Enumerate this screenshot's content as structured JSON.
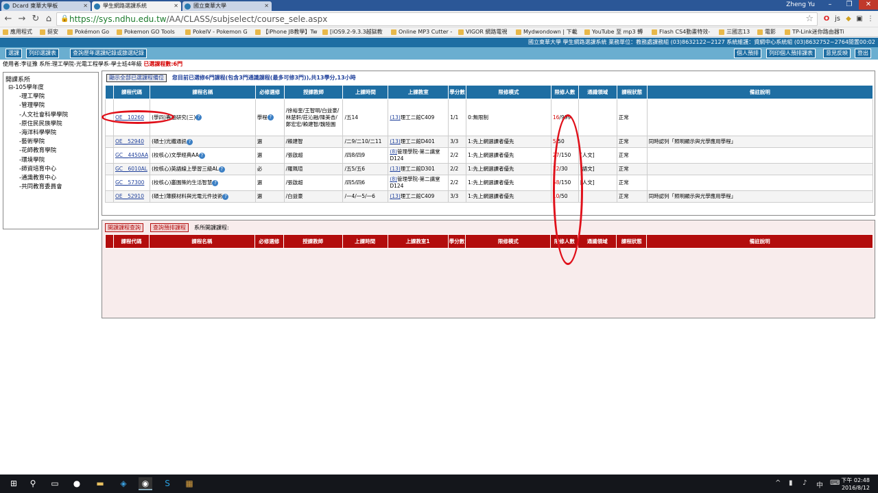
{
  "browser": {
    "tabs": [
      {
        "label": "Dcard 東華大學板",
        "active": false
      },
      {
        "label": "學生網路選課系統",
        "active": true
      },
      {
        "label": "國立東華大學",
        "active": false
      }
    ],
    "user": "Zheng Yu",
    "url_main": "https://sys.ndhu.edu.tw",
    "url_path": "/AA/CLASS/subjselect/course_sele.aspx",
    "bookmarks": [
      "應用程式",
      "挺安",
      "Pokémon Go",
      "Pokemon GO Tools",
      "PokeIV - Pokemon G",
      "【iPhone JB教學】Tw",
      "[iOS9.2-9.3.3越獄教",
      "Online MP3 Cutter -",
      "VIGOR 網路電視",
      "Mydwondown | 下載",
      "YouTube 至 mp3 轉",
      "Flash CS4動畫特效-",
      "三國志13",
      "電影",
      "TP-Link迷你路由器Ti"
    ]
  },
  "system": {
    "header": "國立東華大學 學生網路選課系統 業務單位：教務處課務組 (03)8632122~2127 系統維護：資網中心系統組 (03)8632752~2764閒置00:02",
    "toolbar_left": [
      "選課",
      "列印選課表",
      "查詢歷年選課紀錄或篩選紀錄"
    ],
    "toolbar_right": [
      "個人預排",
      "列印個人預排課表",
      "意見反映",
      "登出"
    ],
    "user_line": "使用者:李征豫 系所:理工學院-光電工程學系-學士班4年級 ",
    "selected_count": "已選課程數:6門"
  },
  "tree": {
    "root": "開課系所",
    "year": "⊟-105學年度",
    "items": [
      "理工學院",
      "管理學院",
      "人文社會科學學院",
      "原住民民族學院",
      "海洋科學學院",
      "藝術學院",
      "花師教育學院",
      "環境學院",
      "師資培育中心",
      "通識教育中心",
      "共同教育委員會"
    ]
  },
  "selected": {
    "show_all_btn": "顯示全部已選課程備位",
    "summary": "您目前已選修6門課程(包含3門通識課程(最多可修3門)),共13學分,13小時",
    "headers": [
      "",
      "課程代碼",
      "課程名稱",
      "必修選修",
      "授課教師",
      "上課時間",
      "上課教室",
      "學分數",
      "限修模式",
      "限修人數",
      "通識領域",
      "課程狀態",
      "備註說明"
    ],
    "rows": [
      {
        "code": "OE__10260",
        "name": "(學四)專題研究(三)",
        "req": "學程",
        "teacher": "/徐裕奎/王智明/白益豪/林楚軒/莊沁融/陳美杏/鄭宏宏/賴建智/魏陸園",
        "time": "/五14",
        "room_n": "(13)",
        "room": "理工二館C409",
        "credit": "1/1",
        "mode": "0:無限制",
        "quota_a": "16",
        "quota_b": "/999",
        "area": "",
        "status": "正常",
        "note": ""
      },
      {
        "code": "OE__52940",
        "name": "(碩士)光纖通訊",
        "req": "選",
        "teacher": "/賴建智",
        "time": "/二9/二10/二11",
        "room_n": "(13)",
        "room": "理工二館D401",
        "credit": "3/3",
        "mode": "1:先上網選課者優先",
        "quota_a": "5",
        "quota_b": "/50",
        "area": "",
        "status": "正常",
        "note": "同時認列「照明顯示與光學應用學程」"
      },
      {
        "code": "GC__4450AA",
        "name": "(校核心)文學經典AA",
        "req": "選",
        "teacher": "/張啟超",
        "time": "/四8/四9",
        "room_n": "(8)",
        "room": "管理學院-第二講堂D124",
        "credit": "2/2",
        "mode": "1:先上網選課者優先",
        "quota_a": "27",
        "quota_b": "/150",
        "area": "[人文]",
        "status": "正常",
        "note": ""
      },
      {
        "code": "GC__6010AL",
        "name": "(校核心)英語線上學習三級AL",
        "req": "必",
        "teacher": "/羅珮瑄",
        "time": "/五5/五6",
        "room_n": "(13)",
        "room": "理工二館D301",
        "credit": "2/2",
        "mode": "1:先上網選課者優先",
        "quota_a": "12",
        "quota_b": "/30",
        "area": "[語文]",
        "status": "正常",
        "note": ""
      },
      {
        "code": "GC__57300",
        "name": "(校核心)叢園策的生活智慧",
        "req": "選",
        "teacher": "/張啟超",
        "time": "/四5/四6",
        "room_n": "(8)",
        "room": "管理學院-第二講堂D124",
        "credit": "2/2",
        "mode": "1:先上網選課者優先",
        "quota_a": "58",
        "quota_b": "/150",
        "area": "[人文]",
        "status": "正常",
        "note": ""
      },
      {
        "code": "OE__52910",
        "name": "(碩士)薄膜材料與光電元件技術",
        "req": "選",
        "teacher": "/白益豪",
        "time": "/一4/一5/一6",
        "room_n": "(13)",
        "room": "理工二館C409",
        "credit": "3/3",
        "mode": "1:先上網選課者優先",
        "quota_a": "10",
        "quota_b": "/50",
        "area": "",
        "status": "正常",
        "note": "同時認列「照明顯示與光學應用學程」"
      }
    ]
  },
  "offered": {
    "btn1": "開課課程查詢",
    "btn2": "查詢預排課程",
    "label": "系所開課課程:",
    "headers": [
      "",
      "課程代碼",
      "課程名稱",
      "必修選修",
      "授課教師",
      "上課時間",
      "上課教室1",
      "學分數",
      "限修模式",
      "限修人數",
      "通識領域",
      "課程狀態",
      "備註說明"
    ]
  },
  "taskbar": {
    "time": "下午 02:48",
    "date": "2016/8/12"
  }
}
